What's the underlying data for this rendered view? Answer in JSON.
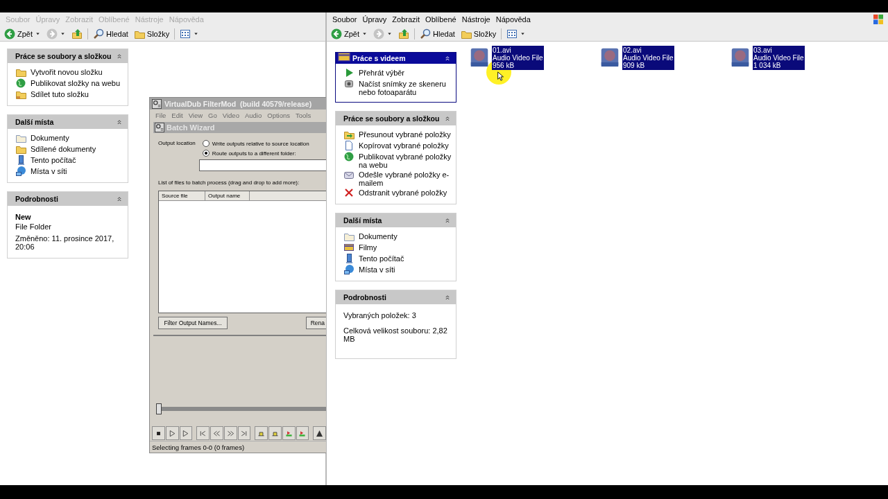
{
  "left_window": {
    "active": false,
    "menu": [
      "Soubor",
      "Úpravy",
      "Zobrazit",
      "Oblíbené",
      "Nástroje",
      "Nápověda"
    ],
    "toolbar": {
      "back": "Zpět",
      "search": "Hledat",
      "folders": "Složky"
    },
    "panes": [
      {
        "title": "Práce se soubory a složkou",
        "items": [
          "Vytvořit novou složku",
          "Publikovat složky na webu",
          "Sdílet tuto složku"
        ]
      },
      {
        "title": "Další místa",
        "items": [
          "Dokumenty",
          "Sdílené dokumenty",
          "Tento počítač",
          "Místa v síti"
        ]
      }
    ],
    "details": {
      "title": "Podrobnosti",
      "name": "New",
      "type": "File Folder",
      "modified": "Změněno: 11. prosince 2017, 20:06"
    }
  },
  "virtualdub": {
    "title": "VirtualDub FilterMod  (build 40579/release)",
    "menu": [
      "File",
      "Edit",
      "View",
      "Go",
      "Video",
      "Audio",
      "Options",
      "Tools"
    ],
    "batch_wizard": {
      "title": "Batch Wizard",
      "output_label": "Output location",
      "radios": [
        {
          "label": "Write outputs relative to source location",
          "selected": false
        },
        {
          "label": "Route outputs to a different folder:",
          "selected": true
        }
      ],
      "list_label": "List of files to batch process (drag and drop to add more):",
      "columns": [
        "Source file",
        "Output name"
      ],
      "buttons": [
        "Filter Output Names...",
        "Rena"
      ]
    },
    "position": {
      "level": 0
    },
    "status": "Selecting frames 0-0 (0 frames)"
  },
  "right_window": {
    "active": true,
    "menu": [
      "Soubor",
      "Úpravy",
      "Zobrazit",
      "Oblíbené",
      "Nástroje",
      "Nápověda"
    ],
    "toolbar": {
      "back": "Zpět",
      "search": "Hledat",
      "folders": "Složky"
    },
    "video_pane": {
      "title": "Práce s videem",
      "items": [
        "Přehrát výběr",
        "Načíst snímky ze skeneru nebo fotoaparátu"
      ]
    },
    "panes": [
      {
        "title": "Práce se soubory a složkou",
        "items": [
          "Přesunout vybrané položky",
          "Kopírovat vybrané položky",
          "Publikovat vybrané položky na webu",
          "Odešle vybrané položky e-mailem",
          "Odstranit vybrané položky"
        ]
      },
      {
        "title": "Další místa",
        "items": [
          "Dokumenty",
          "Filmy",
          "Tento počítač",
          "Místa v síti"
        ]
      }
    ],
    "details": {
      "title": "Podrobnosti",
      "lines": [
        "Vybraných položek: 3",
        "Celková velikost souboru: 2,82 MB"
      ]
    },
    "files": [
      {
        "name": "01.avi",
        "type": "Audio Video File",
        "size": "956 kB",
        "selected": true
      },
      {
        "name": "02.avi",
        "type": "Audio Video File",
        "size": "909 kB",
        "selected": true
      },
      {
        "name": "03.avi",
        "type": "Audio Video File",
        "size": "1 034 kB",
        "selected": true
      }
    ]
  }
}
